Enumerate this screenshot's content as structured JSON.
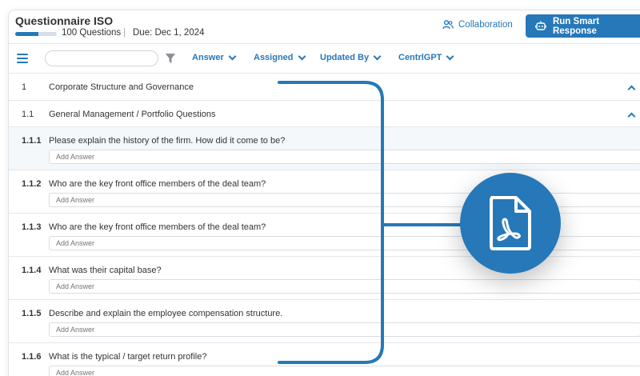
{
  "header": {
    "title": "Questionnaire ISO",
    "progress_pct": 55,
    "question_count": "100 Questions",
    "separator": "|",
    "due": "Due: Dec 1, 2024",
    "collaboration_label": "Collaboration",
    "run_label": "Run Smart Response"
  },
  "toolbar": {
    "search_placeholder": "",
    "filters": [
      "Answer",
      "Assigned",
      "Updated By",
      "CentrlGPT"
    ]
  },
  "sections": [
    {
      "num": "1",
      "label": "Corporate Structure and Governance"
    },
    {
      "num": "1.1",
      "label": "General Management / Portfolio Questions"
    }
  ],
  "questions": [
    {
      "num": "1.1.1",
      "text": "Please explain the history of the firm. How did it come to be?",
      "placeholder": "Add Answer"
    },
    {
      "num": "1.1.2",
      "text": "Who are the key front office members of the deal team?",
      "placeholder": "Add Answer"
    },
    {
      "num": "1.1.3",
      "text": "Who are the key front office members of the deal team?",
      "placeholder": "Add Answer"
    },
    {
      "num": "1.1.4",
      "text": "What was their capital base?",
      "placeholder": "Add Answer"
    },
    {
      "num": "1.1.5",
      "text": "Describe and explain the employee compensation structure.",
      "placeholder": "Add Answer"
    },
    {
      "num": "1.1.6",
      "text": "What is the typical / target return profile?",
      "placeholder": "Add Answer"
    }
  ],
  "overlay": {
    "icon": "pdf-file-icon",
    "accent": "#2678b8"
  },
  "colors": {
    "accent": "#2678b8",
    "border": "#e3e6ea"
  }
}
